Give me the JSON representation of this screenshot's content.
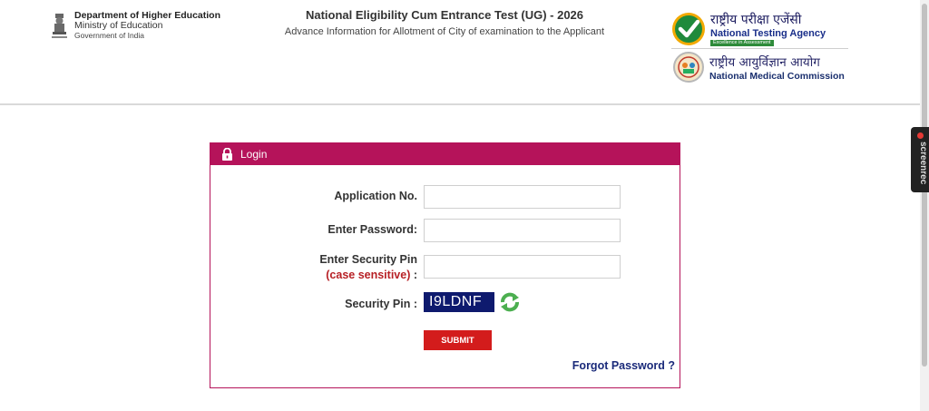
{
  "header": {
    "dept": {
      "line1": "Department of Higher Education",
      "line2": "Ministry of Education",
      "line3": "Government of India"
    },
    "title": "National Eligibility Cum Entrance Test (UG) - 2026",
    "subtitle": "Advance Information for Allotment of City of examination to the Applicant",
    "nta": {
      "hindi": "राष्ट्रीय परीक्षा एजेंसी",
      "english": "National Testing Agency",
      "tagline": "Excellence in Assessment"
    },
    "nmc": {
      "hindi": "राष्ट्रीय आयुर्विज्ञान आयोग",
      "english": "National Medical Commission"
    }
  },
  "login": {
    "title": "Login",
    "application_label": "Application No.",
    "application_value": "",
    "password_label": "Enter Password:",
    "password_value": "",
    "security_pin_label": "Enter Security Pin",
    "security_pin_sub": "(case sensitive)",
    "security_pin_colon": " :",
    "security_pin_value": "",
    "captcha_label": "Security Pin :",
    "captcha_text": "I9LDNF",
    "submit_label": "SUBMIT",
    "forgot_label": "Forgot Password ?"
  },
  "overlay": {
    "screenrec_label": "screenrec"
  },
  "colors": {
    "accent": "#b5135a",
    "submit": "#d31c1c",
    "captcha_bg": "#0e1a6e",
    "link": "#1a2a7a"
  },
  "icons": [
    "emblem-icon",
    "nta-check-icon",
    "nmc-seal-icon",
    "lock-icon",
    "refresh-icon",
    "record-dot-icon"
  ]
}
